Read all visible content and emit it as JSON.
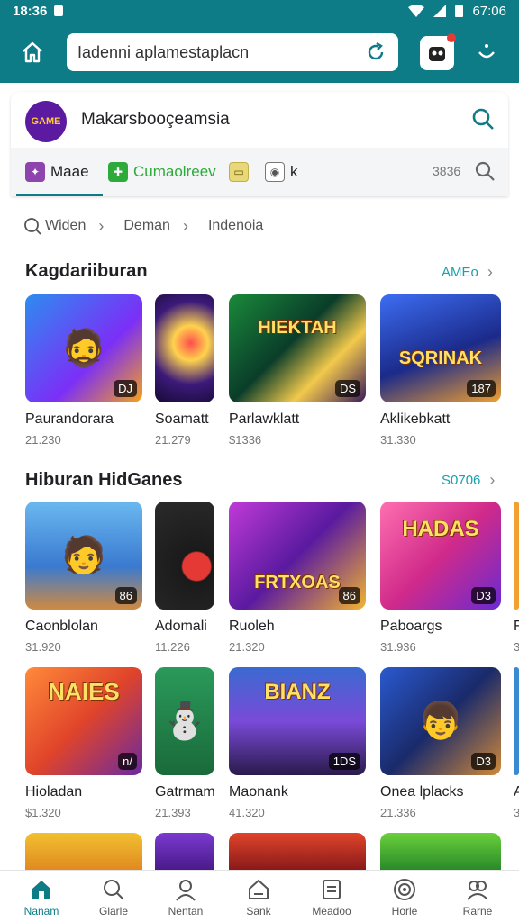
{
  "status_bar": {
    "time": "18:36",
    "right_time": "67:06"
  },
  "browser": {
    "url": "Iadenni aplamestaplacn",
    "icons": {
      "home": "home-icon",
      "reload": "reload-icon",
      "profile": "profile-icon",
      "menu": "menu-icon"
    },
    "accent": "#0e7c86"
  },
  "site": {
    "name": "Makarsbooçeamsia",
    "logo_text": "GAME"
  },
  "tabs": {
    "items": [
      {
        "label": "Maae",
        "color": "#8e44ad"
      },
      {
        "label": "Cumaolreev",
        "color": "#2eaa3a"
      },
      {
        "label": "",
        "color": "#e8d87a"
      },
      {
        "label": "k",
        "color": "#ffffff"
      }
    ],
    "count": "3836"
  },
  "breadcrumb": [
    "Widen",
    "Deman",
    "Indenoia"
  ],
  "sections": [
    {
      "title": "Kagdariiburan",
      "more": "AMEo",
      "tiles": [
        {
          "name": "Paurandorara",
          "meta": "21.230",
          "badge": "DJ"
        },
        {
          "name": "Soamatt",
          "meta": "21.279",
          "badge": ""
        },
        {
          "name": "Parlawklatt",
          "meta": "$1336",
          "badge": "DS"
        },
        {
          "name": "Aklikebkatt",
          "meta": "31.330",
          "badge": "187"
        }
      ]
    },
    {
      "title": "Hiburan HidGanes",
      "more": "S0706",
      "tiles": [
        {
          "name": "Caonblolan",
          "meta": "31.920",
          "badge": "86"
        },
        {
          "name": "Adomali",
          "meta": "11.226",
          "badge": ""
        },
        {
          "name": "Ruoleh",
          "meta": "21.320",
          "badge": "86"
        },
        {
          "name": "Paboargs",
          "meta": "31.936",
          "badge": "D3"
        },
        {
          "name": "F",
          "meta": "3",
          "badge": ""
        }
      ]
    },
    {
      "title": "",
      "more": "",
      "tiles": [
        {
          "name": "Hioladan",
          "meta": "$1.320",
          "badge": "n/"
        },
        {
          "name": "Gatrmami",
          "meta": "21.393",
          "badge": ""
        },
        {
          "name": "Maonank",
          "meta": "41.320",
          "badge": "1DS"
        },
        {
          "name": "Onea lplacks",
          "meta": "21.336",
          "badge": "D3"
        },
        {
          "name": "A",
          "meta": "3",
          "badge": ""
        }
      ]
    }
  ],
  "thumb_words": {
    "s1_2": "HIEKTAH",
    "s1_3": "SQRINAK",
    "s2_2": "FRTXOAS",
    "s2_3": "HADAS",
    "s3_0": "NAIES",
    "s3_2": "BIANZ"
  },
  "bottom_nav": [
    {
      "label": "Nanam",
      "icon": "home-icon",
      "active": true
    },
    {
      "label": "Glarle",
      "icon": "search-icon"
    },
    {
      "label": "Nentan",
      "icon": "person-icon"
    },
    {
      "label": "Sank",
      "icon": "house-icon"
    },
    {
      "label": "Meadoo",
      "icon": "document-icon"
    },
    {
      "label": "Horle",
      "icon": "target-icon"
    },
    {
      "label": "Rarne",
      "icon": "group-icon"
    }
  ]
}
